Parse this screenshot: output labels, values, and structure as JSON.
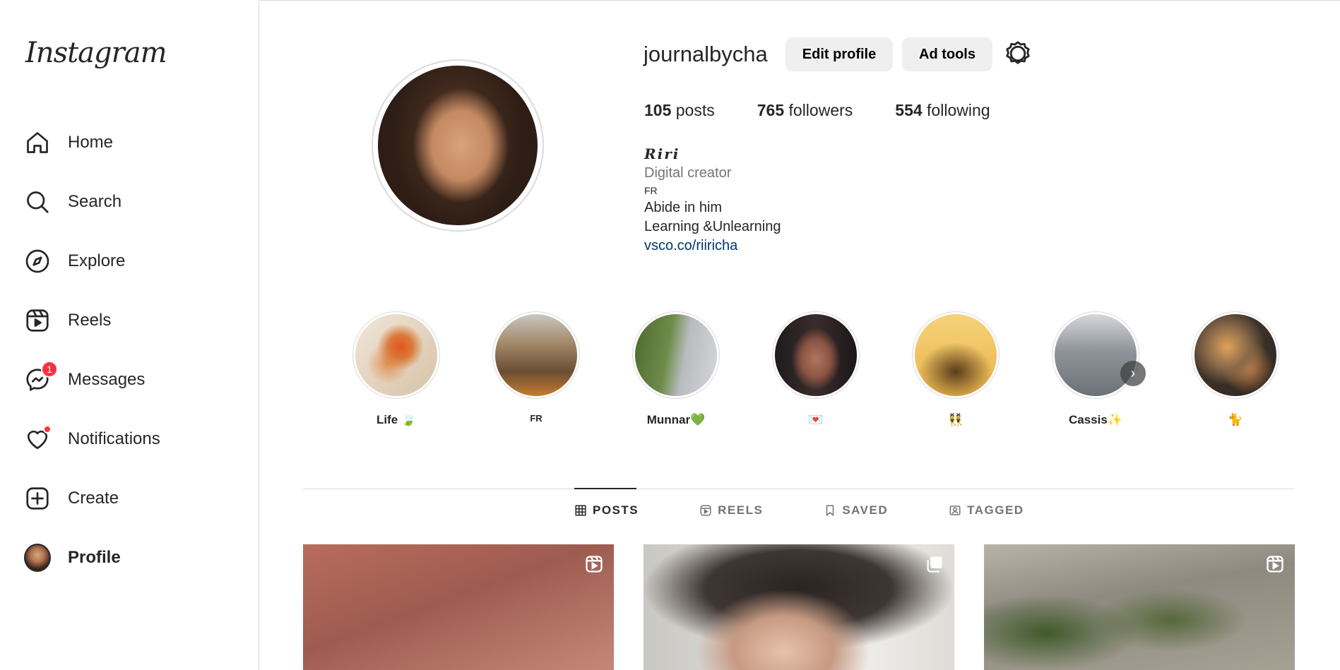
{
  "sidebar": {
    "logo": "Instagram",
    "items": [
      {
        "label": "Home",
        "icon": "home-icon"
      },
      {
        "label": "Search",
        "icon": "search-icon"
      },
      {
        "label": "Explore",
        "icon": "compass-icon"
      },
      {
        "label": "Reels",
        "icon": "reels-icon"
      },
      {
        "label": "Messages",
        "icon": "messenger-icon",
        "badge": "1"
      },
      {
        "label": "Notifications",
        "icon": "heart-icon"
      },
      {
        "label": "Create",
        "icon": "plus-square-icon"
      },
      {
        "label": "Profile",
        "icon": "avatar"
      }
    ]
  },
  "profile": {
    "username": "journalbycha",
    "edit_button": "Edit profile",
    "ad_tools_button": "Ad tools",
    "stats": {
      "posts_count": "105",
      "posts_label": "posts",
      "followers_count": "765",
      "followers_label": "followers",
      "following_count": "554",
      "following_label": "following"
    },
    "bio": {
      "name": "𝑹𝒊𝒓𝒊",
      "category": "Digital creator",
      "line1": "FR",
      "line2": "Abide in him",
      "line3": "Learning &Unlearning",
      "link": "vsco.co/riiricha"
    }
  },
  "highlights": [
    {
      "label": "Life 🍃"
    },
    {
      "label": "FR"
    },
    {
      "label": "Munnar💚"
    },
    {
      "label": "💌"
    },
    {
      "label": "👯"
    },
    {
      "label": "Cassis✨"
    },
    {
      "label": "🐈"
    }
  ],
  "tabs": [
    {
      "label": "POSTS",
      "icon": "grid-icon"
    },
    {
      "label": "REELS",
      "icon": "reels-icon"
    },
    {
      "label": "SAVED",
      "icon": "bookmark-icon"
    },
    {
      "label": "TAGGED",
      "icon": "tagged-icon"
    }
  ],
  "posts": [
    {
      "type": "reel",
      "icon": "reel-icon"
    },
    {
      "type": "carousel",
      "icon": "carousel-icon"
    },
    {
      "type": "reel",
      "icon": "reel-icon"
    }
  ],
  "colors": {
    "badge": "#ff3040",
    "link": "#00376b",
    "button_bg": "#efefef",
    "border": "#dbdbdb"
  }
}
